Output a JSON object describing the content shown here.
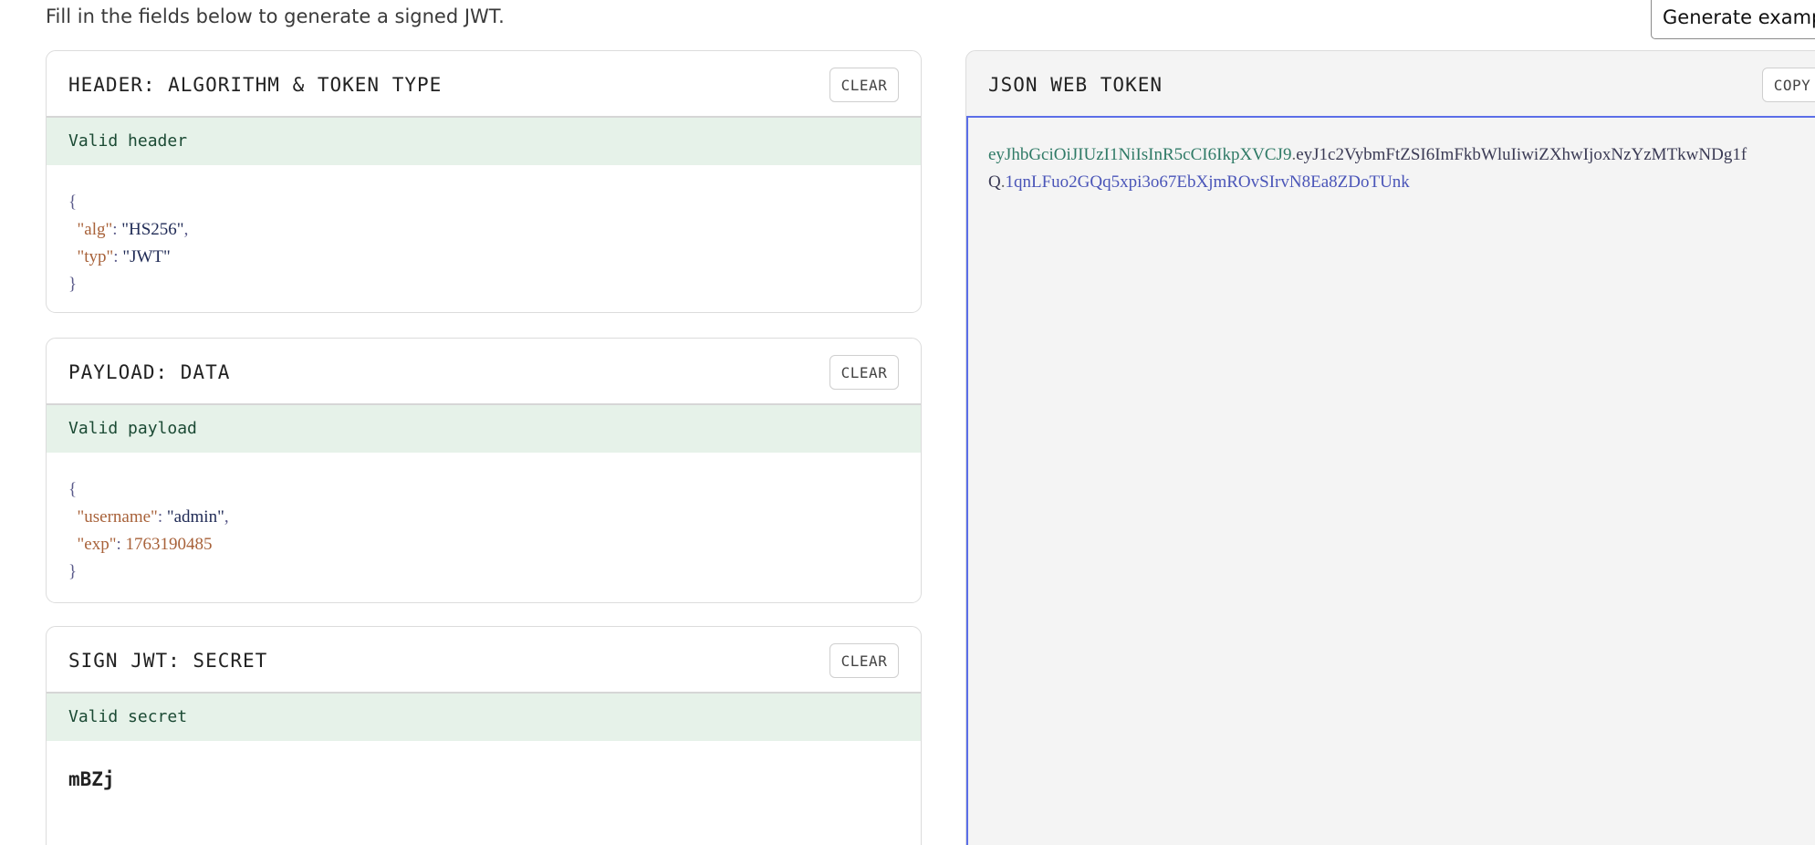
{
  "intro_text": "Fill in the fields below to generate a signed JWT.",
  "generate_button": "Generate examp",
  "header_card": {
    "title": "HEADER: ALGORITHM & TOKEN TYPE",
    "clear_label": "CLEAR",
    "status": "Valid header",
    "open_brace": "{",
    "close_brace": "}",
    "fields": [
      {
        "key": "\"alg\"",
        "sep": ": ",
        "value": "\"HS256\"",
        "trail": ","
      },
      {
        "key": "\"typ\"",
        "sep": ": ",
        "value": "\"JWT\"",
        "trail": ""
      }
    ]
  },
  "payload_card": {
    "title": "PAYLOAD: DATA",
    "clear_label": "CLEAR",
    "status": "Valid payload",
    "open_brace": "{",
    "close_brace": "}",
    "fields": [
      {
        "key": "\"username\"",
        "sep": ": ",
        "value": "\"admin\"",
        "trail": ","
      },
      {
        "key": "\"exp\"",
        "sep": ": ",
        "value": "1763190485",
        "trail": ""
      }
    ]
  },
  "secret_card": {
    "title": "SIGN JWT: SECRET",
    "clear_label": "CLEAR",
    "status": "Valid secret",
    "secret_value": "mBZj"
  },
  "jwt_panel": {
    "title": "JSON WEB TOKEN",
    "copy_label": "COPY",
    "token_header": "eyJhbGciOiJIUzI1NiIsInR5cCI6IkpXVCJ9",
    "dot": ".",
    "token_payload_line1": "eyJ1c2VybmFtZSI6ImFkbWluIiwiZXhwIjoxNzYzMTkwNDg1f",
    "token_payload_line2": "Q",
    "token_signature": "1qnLFuo2GQq5xpi3o67EbXjmROvSIrvN8Ea8ZDoTUnk"
  },
  "colors": {
    "valid_bg": "#e6f2e9",
    "valid_text": "#1b4a34",
    "accent_border": "#5b6ee8",
    "json_key": "#a8623a",
    "json_string": "#1f2a55"
  }
}
